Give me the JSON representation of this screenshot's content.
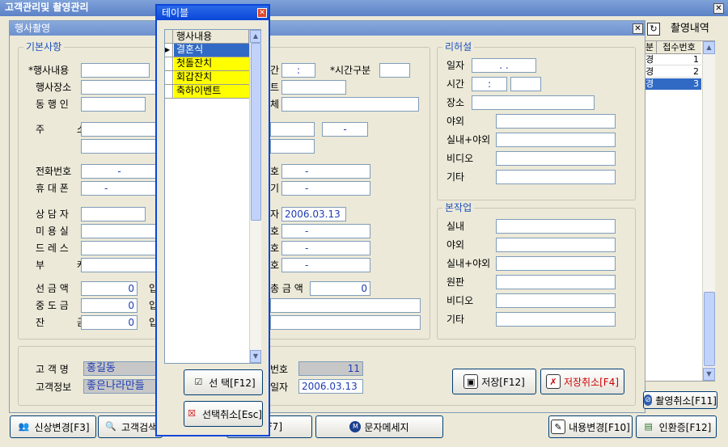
{
  "app": {
    "title": "고객관리및 촬영관리"
  },
  "inner": {
    "title": "행사촬영"
  },
  "right_panel": {
    "title": "촬영내역",
    "headers": [
      "분",
      "접수번호"
    ],
    "rows": [
      {
        "a": "경",
        "b": "1"
      },
      {
        "a": "경",
        "b": "2"
      },
      {
        "a": "경",
        "b": "3"
      }
    ]
  },
  "basic": {
    "title": "기본사항",
    "labels": {
      "event": "*행사내용",
      "place": "행사장소",
      "companion": "동 행 인",
      "address": "주 소",
      "phone": "전화번호",
      "mobile": "휴 대 폰",
      "counselor": "상 담 자",
      "beauty": "미 용 실",
      "dress": "드 레 스",
      "bouquet": "부 케",
      "deposit": "선 금 액",
      "middle": "중 도 금",
      "balance": "잔 금"
    },
    "partial_labels": {
      "time": "간",
      "time_type": "*시간구분",
      "row2": "트",
      "row3": "체",
      "row6": "호",
      "row7": "기",
      "row8": "자",
      "row9": "호",
      "row10": "호",
      "row11": "호",
      "total": "총 금 액",
      "in1": "입",
      "in2": "입",
      "in3": "입"
    },
    "values": {
      "time": ":",
      "addr_dash": "-",
      "phone": "-",
      "mobile": "-",
      "r_phone": "-",
      "r_mobile": "-",
      "date": "2006.03.13",
      "d1": "-",
      "d2": "-",
      "d3": "-",
      "deposit": "0",
      "middle": "0",
      "balance": "0",
      "total": "0"
    }
  },
  "rehearsal": {
    "title": "리허설",
    "labels": {
      "date": "일자",
      "time": "시간",
      "place": "장소",
      "outdoor": "야외",
      "inout": "실내+야외",
      "video": "비디오",
      "etc": "기타"
    },
    "values": {
      "date": ". .",
      "time": ":"
    }
  },
  "main_work": {
    "title": "본작업",
    "labels": {
      "indoor": "실내",
      "outdoor": "야외",
      "inout": "실내+야외",
      "original": "원판",
      "video": "비디오",
      "etc": "기타"
    }
  },
  "customer": {
    "name_label": "고 객 명",
    "name": "홍길동",
    "info_label": "고객정보",
    "info": "좋은나라만들",
    "no_label": "번호",
    "no": "11",
    "date_label": "일자",
    "date": "2006.03.13"
  },
  "buttons": {
    "save": "저장[F12]",
    "cancel_save": "저장취소[F4]",
    "cancel_shoot": "촬영취소[F11]",
    "change_product": "신상변경[F3]",
    "customer_search": "고객검색",
    "f7": "F7]",
    "sms": "문자메세지",
    "content_change": "내용변경[F10]",
    "print": "인환증[F12]"
  },
  "popup": {
    "title": "테이블",
    "header": "행사내용",
    "items": [
      "결혼식",
      "첫돌잔치",
      "회갑잔치",
      "축하이벤트"
    ],
    "select": "선 택[F12]",
    "deselect": "선택취소[Esc]"
  }
}
